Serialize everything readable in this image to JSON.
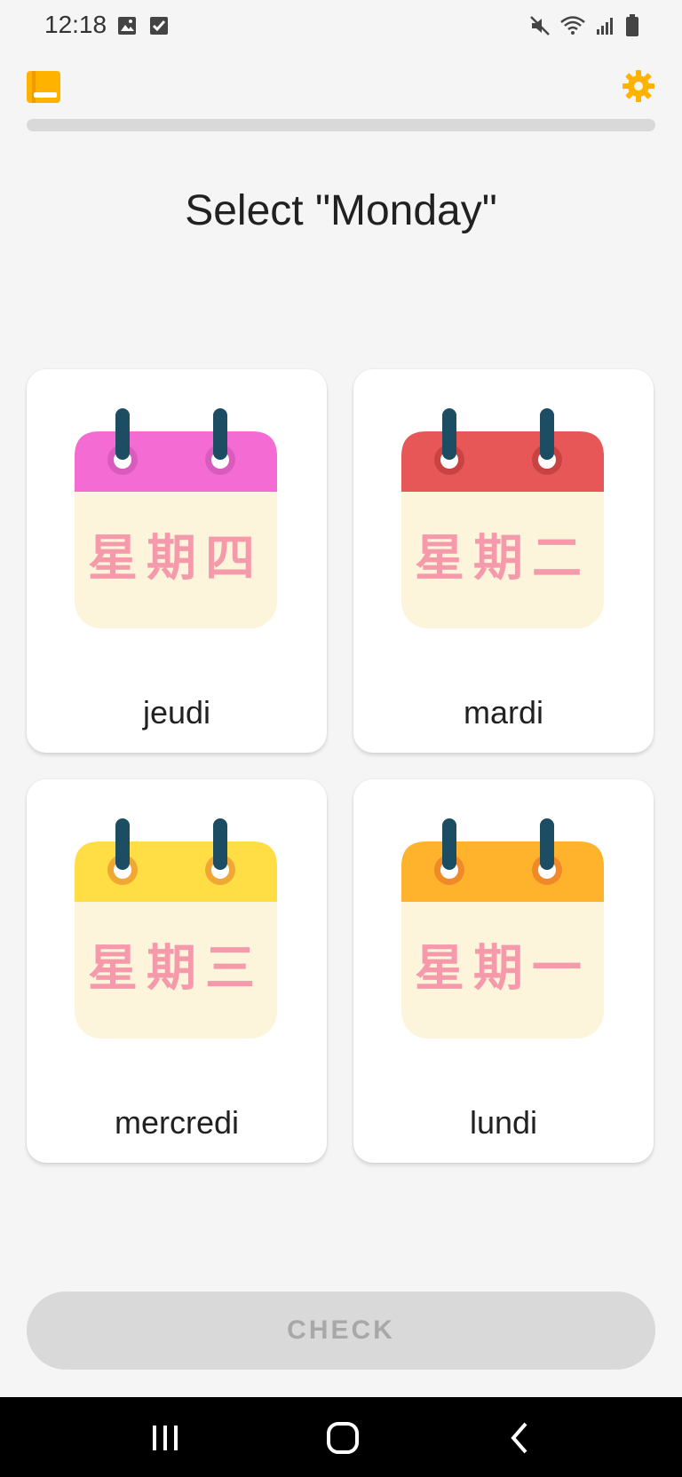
{
  "status_bar": {
    "time": "12:18",
    "icons": [
      "image-icon",
      "checkbox-icon",
      "mute-icon",
      "wifi-icon",
      "signal-icon",
      "battery-icon"
    ]
  },
  "top_bar": {
    "left_icon": "book-icon",
    "right_icon": "gear-icon",
    "accent_color": "#ffb300",
    "progress_fraction": 0
  },
  "prompt": "Select \"Monday\"",
  "cards": [
    {
      "label": "jeudi",
      "calendar_text": "星期四",
      "header_color": "#f36bd3",
      "ring_color": "#d95bbd"
    },
    {
      "label": "mardi",
      "calendar_text": "星期二",
      "header_color": "#e85757",
      "ring_color": "#c94343"
    },
    {
      "label": "mercredi",
      "calendar_text": "星期三",
      "header_color": "#ffde45",
      "ring_color": "#f0a733"
    },
    {
      "label": "lundi",
      "calendar_text": "星期一",
      "header_color": "#ffb32c",
      "ring_color": "#f08a28"
    }
  ],
  "check_button": {
    "label": "CHECK"
  },
  "nav_bar": {
    "icons": [
      "recent-apps-icon",
      "home-icon",
      "back-icon"
    ]
  }
}
